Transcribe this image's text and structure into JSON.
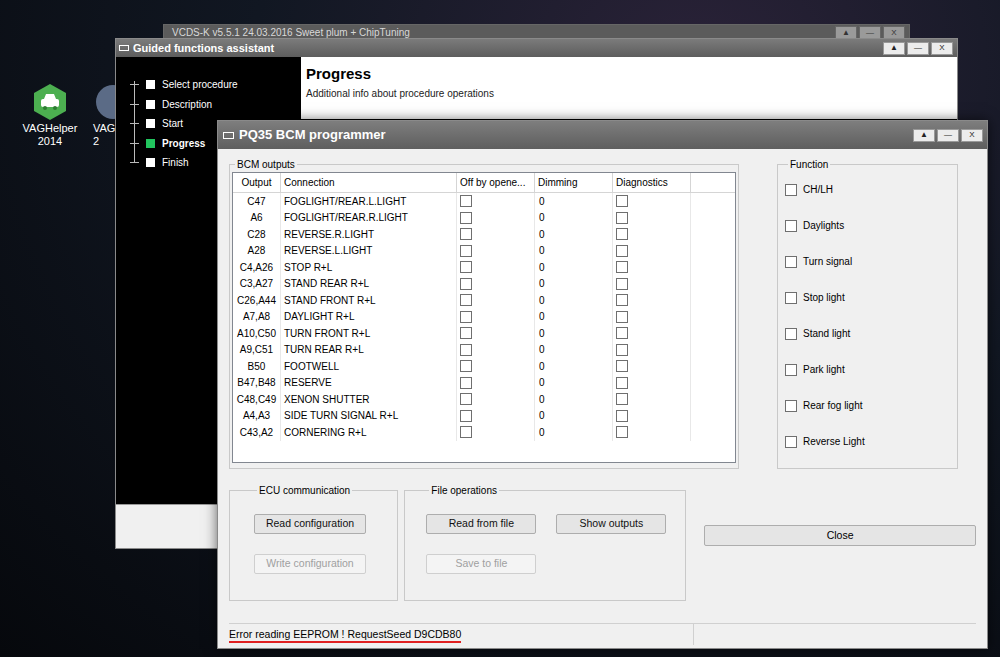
{
  "desktop_icons": [
    {
      "lines": [
        "VAGHelper",
        "2014"
      ],
      "color": "#4caf50"
    },
    {
      "lines": [
        "VAG",
        "2"
      ],
      "color": "#5b6b86"
    }
  ],
  "background_window": {
    "title": "VCDS-K v5.5.1 24.03.2016 Sweet plum + ChipTuning",
    "controls": [
      "▲",
      "—",
      "X"
    ]
  },
  "assistant": {
    "title": "Guided functions assistant",
    "controls": [
      "▲",
      "—",
      "X"
    ],
    "steps": [
      {
        "label": "Select procedure",
        "selected": false
      },
      {
        "label": "Description",
        "selected": false
      },
      {
        "label": "Start",
        "selected": false
      },
      {
        "label": "Progress",
        "selected": true
      },
      {
        "label": "Finish",
        "selected": false
      }
    ],
    "header": {
      "title": "Progress",
      "subtitle": "Additional info about procedure operations"
    }
  },
  "programmer": {
    "title": "PQ35 BCM programmer",
    "controls": [
      "▲",
      "—",
      "X"
    ],
    "outputs_group": "BCM outputs",
    "columns": [
      "Output",
      "Connection",
      "Off by opene...",
      "Dimming",
      "Diagnostics"
    ],
    "rows": [
      {
        "output": "C47",
        "connection": "FOGLIGHT/REAR.L.LIGHT",
        "off_by_opener": false,
        "dimming": "0",
        "diagnostics": false
      },
      {
        "output": "A6",
        "connection": "FOGLIGHT/REAR.R.LIGHT",
        "off_by_opener": false,
        "dimming": "0",
        "diagnostics": false
      },
      {
        "output": "C28",
        "connection": "REVERSE.R.LIGHT",
        "off_by_opener": false,
        "dimming": "0",
        "diagnostics": false
      },
      {
        "output": "A28",
        "connection": "REVERSE.L.LIGHT",
        "off_by_opener": false,
        "dimming": "0",
        "diagnostics": false
      },
      {
        "output": "C4,A26",
        "connection": "STOP R+L",
        "off_by_opener": false,
        "dimming": "0",
        "diagnostics": false
      },
      {
        "output": "C3,A27",
        "connection": "STAND REAR R+L",
        "off_by_opener": false,
        "dimming": "0",
        "diagnostics": false
      },
      {
        "output": "C26,A44",
        "connection": "STAND FRONT R+L",
        "off_by_opener": false,
        "dimming": "0",
        "diagnostics": false
      },
      {
        "output": "A7,A8",
        "connection": "DAYLIGHT R+L",
        "off_by_opener": false,
        "dimming": "0",
        "diagnostics": false
      },
      {
        "output": "A10,C50",
        "connection": "TURN FRONT R+L",
        "off_by_opener": false,
        "dimming": "0",
        "diagnostics": false
      },
      {
        "output": "A9,C51",
        "connection": "TURN REAR R+L",
        "off_by_opener": false,
        "dimming": "0",
        "diagnostics": false
      },
      {
        "output": "B50",
        "connection": "FOOTWELL",
        "off_by_opener": false,
        "dimming": "0",
        "diagnostics": false
      },
      {
        "output": "B47,B48",
        "connection": "RESERVE",
        "off_by_opener": false,
        "dimming": "0",
        "diagnostics": false
      },
      {
        "output": "C48,C49",
        "connection": "XENON SHUTTER",
        "off_by_opener": false,
        "dimming": "0",
        "diagnostics": false
      },
      {
        "output": "A4,A3",
        "connection": "SIDE TURN SIGNAL R+L",
        "off_by_opener": false,
        "dimming": "0",
        "diagnostics": false
      },
      {
        "output": "C43,A2",
        "connection": "CORNERING R+L",
        "off_by_opener": false,
        "dimming": "0",
        "diagnostics": false
      }
    ],
    "function_group": "Function",
    "functions": [
      {
        "label": "CH/LH",
        "checked": false
      },
      {
        "label": "Daylights",
        "checked": false
      },
      {
        "label": "Turn signal",
        "checked": false
      },
      {
        "label": "Stop light",
        "checked": false
      },
      {
        "label": "Stand light",
        "checked": false
      },
      {
        "label": "Park light",
        "checked": false
      },
      {
        "label": "Rear fog light",
        "checked": false
      },
      {
        "label": "Reverse Light",
        "checked": false
      }
    ],
    "ecu_group": "ECU communication",
    "ecu_buttons": [
      {
        "label": "Read configuration",
        "disabled": false
      },
      {
        "label": "Write configuration",
        "disabled": true
      }
    ],
    "file_group": "File operations",
    "file_buttons": [
      {
        "label": "Read from file",
        "disabled": false
      },
      {
        "label": "Show outputs",
        "disabled": false
      },
      {
        "label": "Save to file",
        "disabled": true
      }
    ],
    "close_button": "Close",
    "status": "Error reading EEPROM ! RequestSeed D9CDB80"
  }
}
